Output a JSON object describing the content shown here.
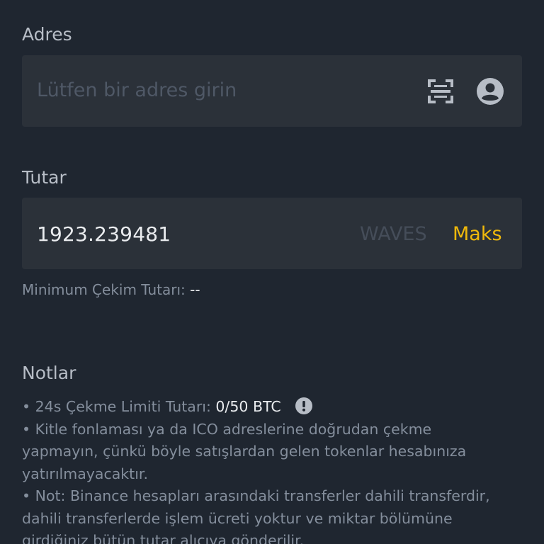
{
  "address": {
    "label": "Adres",
    "placeholder": "Lütfen bir adres girin",
    "scan_icon": "qr-scan-icon",
    "contact_icon": "user-circle-icon"
  },
  "amount": {
    "label": "Tutar",
    "value": "1923.239481",
    "currency": "WAVES",
    "max_label": "Maks"
  },
  "minimum": {
    "label": "Minimum Çekim Tutarı:",
    "value": "--"
  },
  "notes": {
    "title": "Notlar",
    "limit_prefix": "• 24s Çekme Limiti Tutarı:",
    "limit_value": "0/50 BTC",
    "info_icon": "exclamation-circle-icon",
    "lines": [
      "• Kitle fonlaması ya da ICO adreslerine doğrudan çekme",
      "yapmayın, çünkü böyle satışlardan gelen tokenlar hesabınıza",
      "yatırılmayacaktır.",
      "• Not: Binance hesapları arasındaki transferler dahili transferdir,",
      "dahili transferlerde işlem ücreti yoktur ve miktar bölümüne",
      "girdiğiniz bütün tutar alıcıya gönderilir."
    ]
  },
  "colors": {
    "background": "#1f2630",
    "field": "#2b3139",
    "accent": "#f0b90b",
    "muted_text": "#848e9c",
    "primary_text": "#eaecef"
  }
}
